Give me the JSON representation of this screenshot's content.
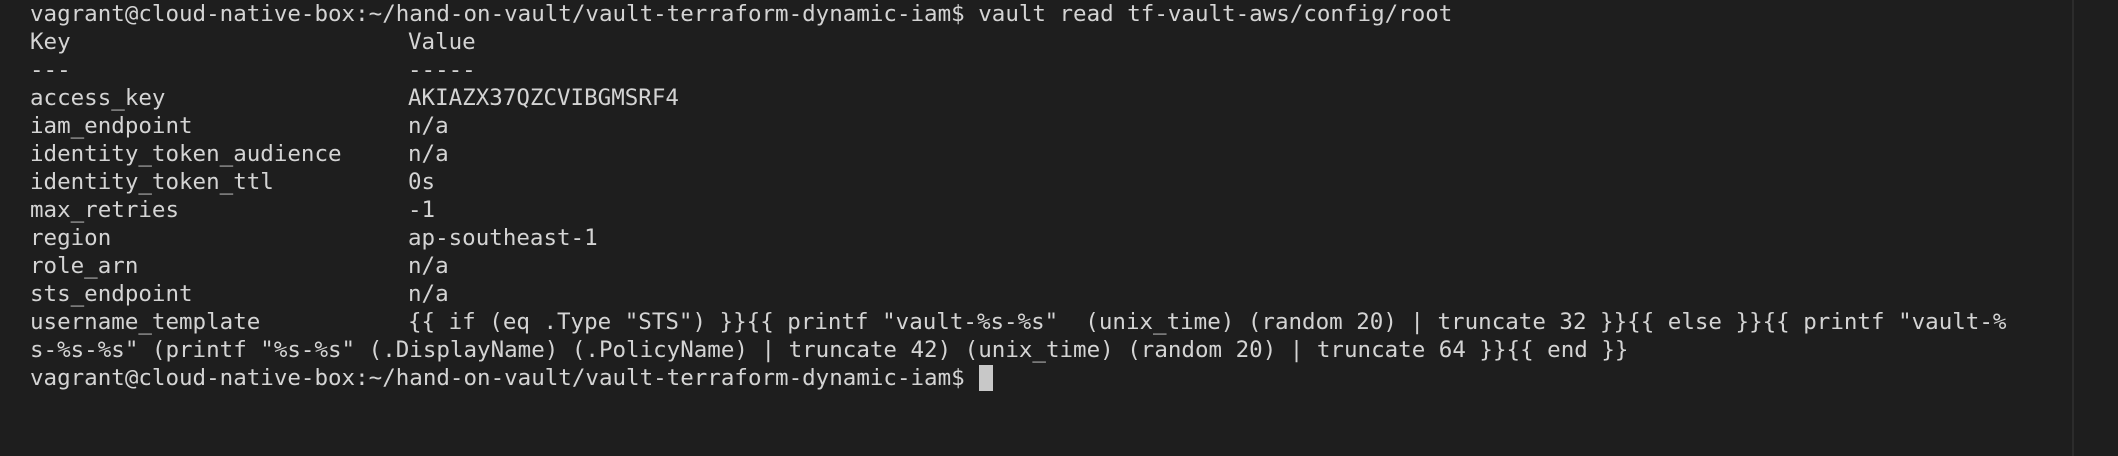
{
  "terminal": {
    "prompt_line_1": "vagrant@cloud-native-box:~/hand-on-vault/vault-terraform-dynamic-iam$ vault read tf-vault-aws/config/root",
    "header": {
      "key": "Key",
      "value": "Value"
    },
    "separator": {
      "key": "---",
      "value": "-----"
    },
    "rows": [
      {
        "key": "access_key",
        "value": "AKIAZX37QZCVIBGMSRF4"
      },
      {
        "key": "iam_endpoint",
        "value": "n/a"
      },
      {
        "key": "identity_token_audience",
        "value": "n/a"
      },
      {
        "key": "identity_token_ttl",
        "value": "0s"
      },
      {
        "key": "max_retries",
        "value": "-1"
      },
      {
        "key": "region",
        "value": "ap-southeast-1"
      },
      {
        "key": "role_arn",
        "value": "n/a"
      },
      {
        "key": "sts_endpoint",
        "value": "n/a"
      },
      {
        "key": "username_template",
        "value": "{{ if (eq .Type \"STS\") }}{{ printf \"vault-%s-%s\"  (unix_time) (random 20) | truncate 32 }}{{ else }}{{ printf \"vault-%"
      }
    ],
    "wrap_line": "s-%s-%s\" (printf \"%s-%s\" (.DisplayName) (.PolicyName) | truncate 42) (unix_time) (random 20) | truncate 64 }}{{ end }}",
    "prompt_line_2": "vagrant@cloud-native-box:~/hand-on-vault/vault-terraform-dynamic-iam$"
  }
}
